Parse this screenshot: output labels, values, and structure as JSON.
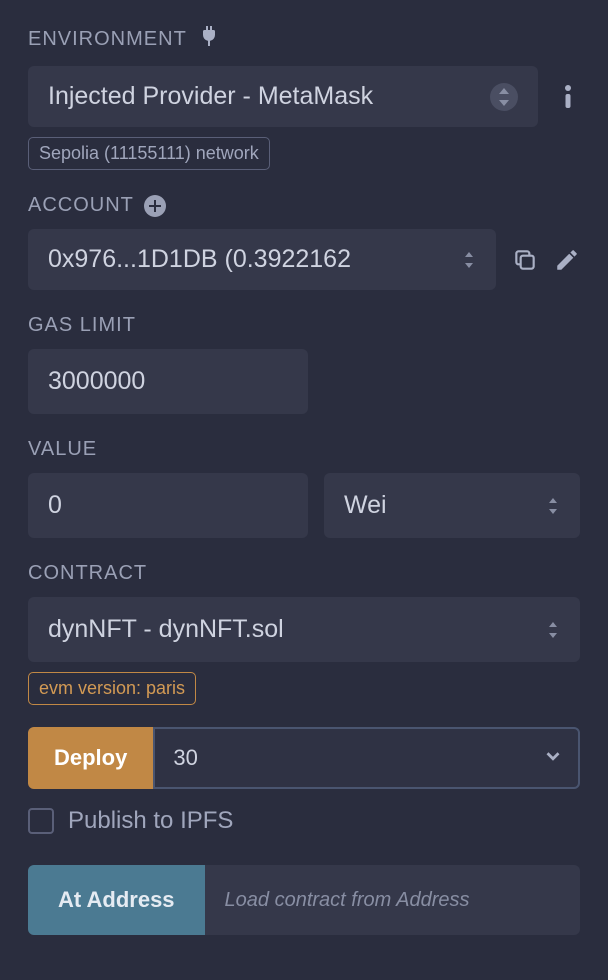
{
  "environment": {
    "label": "ENVIRONMENT",
    "selected": "Injected Provider - MetaMask",
    "network_badge": "Sepolia (11155111) network"
  },
  "account": {
    "label": "ACCOUNT",
    "selected": "0x976...1D1DB (0.3922162"
  },
  "gas": {
    "label": "GAS LIMIT",
    "value": "3000000"
  },
  "value": {
    "label": "VALUE",
    "amount": "0",
    "unit": "Wei"
  },
  "contract": {
    "label": "CONTRACT",
    "selected": "dynNFT - dynNFT.sol",
    "evm_badge": "evm version: paris"
  },
  "deploy": {
    "button": "Deploy",
    "arg": "30"
  },
  "publish": {
    "label": "Publish to IPFS",
    "checked": false
  },
  "ataddress": {
    "button": "At Address",
    "placeholder": "Load contract from Address"
  }
}
